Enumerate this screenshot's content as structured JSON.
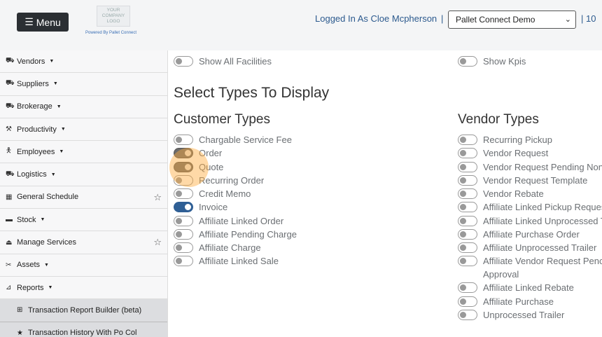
{
  "header": {
    "menu_label": "Menu",
    "logo_text": "YOUR COMPANY LOGO",
    "powered_by": "Powered By Pallet Connect",
    "logged_in": "Logged In As Cloe Mcpherson",
    "separator": "|",
    "org_selected": "Pallet Connect Demo",
    "trailing_text": "| 10"
  },
  "sidebar": {
    "items": [
      {
        "label": "Vendors",
        "icon": "truck-icon"
      },
      {
        "label": "Suppliers",
        "icon": "truck-icon"
      },
      {
        "label": "Brokerage",
        "icon": "truck-icon"
      },
      {
        "label": "Productivity",
        "icon": "hammer-icon"
      },
      {
        "label": "Employees",
        "icon": "person-icon"
      },
      {
        "label": "Logistics",
        "icon": "truck-icon"
      },
      {
        "label": "General Schedule",
        "icon": "calendar-icon"
      },
      {
        "label": "Stock",
        "icon": "pallet-icon"
      },
      {
        "label": "Manage Services",
        "icon": "eject-icon"
      },
      {
        "label": "Assets",
        "icon": "tools-icon"
      },
      {
        "label": "Reports",
        "icon": "chart-icon"
      }
    ],
    "sub_items": [
      {
        "label": "Transaction Report Builder (beta)",
        "icon": "table-icon"
      },
      {
        "label": "Transaction History With Po Col",
        "icon": "star-icon"
      }
    ]
  },
  "main": {
    "show_all_facilities": "Show All Facilities",
    "show_kpis": "Show Kpis",
    "section_title": "Select Types To Display",
    "customer_title": "Customer Types",
    "vendor_title": "Vendor Types",
    "customer_types": [
      "Chargable Service Fee",
      "Order",
      "Quote",
      "Recurring Order",
      "Credit Memo",
      "Invoice",
      "Affiliate Linked Order",
      "Affiliate Pending Charge",
      "Affiliate Charge",
      "Affiliate Linked Sale"
    ],
    "vendor_types": [
      "Recurring Pickup",
      "Vendor Request",
      "Vendor Request Pending Non",
      "Vendor Request Template",
      "Vendor Rebate",
      "Affiliate Linked Pickup Reques",
      "Affiliate Linked Unprocessed T",
      "Affiliate Purchase Order",
      "Affiliate Unprocessed Trailer",
      "Affiliate Vendor Request Penc",
      "Approval",
      "Affiliate Linked Rebate",
      "Affiliate Purchase",
      "Unprocessed Trailer"
    ]
  }
}
